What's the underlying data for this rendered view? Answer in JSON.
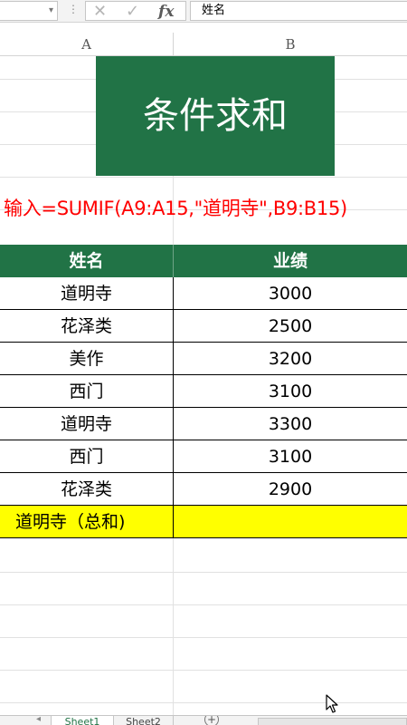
{
  "formula_bar": {
    "name_box_value": "",
    "cancel_icon": "✕",
    "enter_icon": "✓",
    "function_icon": "fx",
    "formula_value": "姓名"
  },
  "columns": [
    "A",
    "B"
  ],
  "title": "条件求和",
  "instruction": "输入=SUMIF(A9:A15,\"道明寺\",B9:B15)",
  "table": {
    "headers": [
      "姓名",
      "业绩"
    ],
    "rows": [
      [
        "道明寺",
        "3000"
      ],
      [
        "花泽类",
        "2500"
      ],
      [
        "美作",
        "3200"
      ],
      [
        "西门",
        "3100"
      ],
      [
        "道明寺",
        "3300"
      ],
      [
        "西门",
        "3100"
      ],
      [
        "花泽类",
        "2900"
      ]
    ],
    "summary_label": "道明寺（总和)",
    "summary_value": ""
  },
  "sheets": [
    "Sheet1",
    "Sheet2"
  ],
  "colors": {
    "accent_green": "#217346",
    "instruction_red": "#ff0000",
    "highlight_yellow": "#ffff00"
  }
}
